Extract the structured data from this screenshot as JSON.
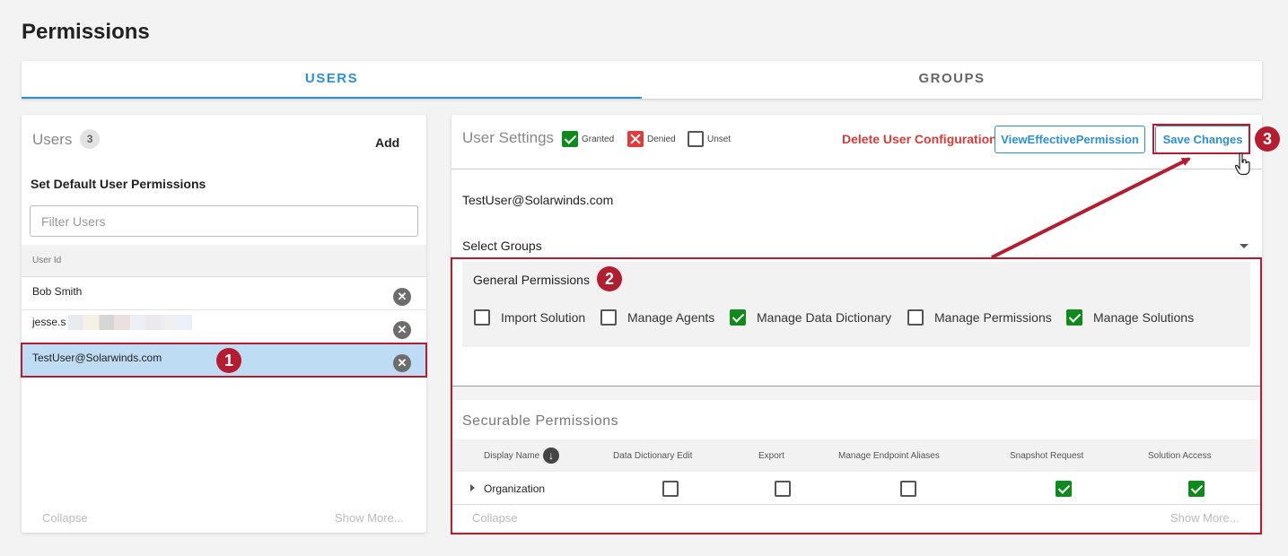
{
  "page": {
    "title": "Permissions"
  },
  "tabs": [
    {
      "label": "USERS"
    },
    {
      "label": "GROUPS"
    }
  ],
  "users_panel": {
    "title": "Users",
    "count": "3",
    "add_label": "Add",
    "default_perm_label": "Set Default User Permissions",
    "filter_placeholder": "Filter Users",
    "column_header": "User Id",
    "users": [
      {
        "name": "Bob Smith"
      },
      {
        "name": "jesse.s"
      },
      {
        "name": "TestUser@Solarwinds.com"
      }
    ],
    "collapse_label": "Collapse",
    "show_more_label": "Show More..."
  },
  "settings_panel": {
    "title": "User Settings",
    "legend": {
      "granted": "Granted",
      "denied": "Denied",
      "unset": "Unset"
    },
    "delete_label": "Delete User Configuration",
    "view_effective_label": "ViewEffectivePermission",
    "save_label": "Save Changes",
    "user_email": "TestUser@Solarwinds.com",
    "select_groups_label": "Select Groups",
    "general": {
      "title": "General Permissions",
      "items": [
        {
          "label": "Import Solution",
          "checked": false
        },
        {
          "label": "Manage Agents",
          "checked": false
        },
        {
          "label": "Manage Data Dictionary",
          "checked": true
        },
        {
          "label": "Manage Permissions",
          "checked": false
        },
        {
          "label": "Manage Solutions",
          "checked": true
        }
      ]
    },
    "securable": {
      "title": "Securable Permissions",
      "columns": [
        "Display Name",
        "Data Dictionary Edit",
        "Export",
        "Manage Endpoint Aliases",
        "Snapshot Request",
        "Solution Access"
      ],
      "rows": [
        {
          "name": "Organization",
          "values": [
            false,
            false,
            false,
            true,
            true
          ]
        }
      ],
      "collapse_label": "Collapse",
      "show_more_label": "Show More..."
    }
  },
  "markers": [
    "1",
    "2",
    "3"
  ],
  "icons": {
    "remove": "close-circle-icon",
    "sort": "arrow-down-circle-icon",
    "expand": "caret-right-icon",
    "dropdown": "caret-down-icon",
    "cursor": "hand-pointer-icon"
  },
  "colors": {
    "accent": "#2b8fd6",
    "granted": "#108a1c",
    "denied": "#e23a3a",
    "annotation": "#b41c2f"
  }
}
